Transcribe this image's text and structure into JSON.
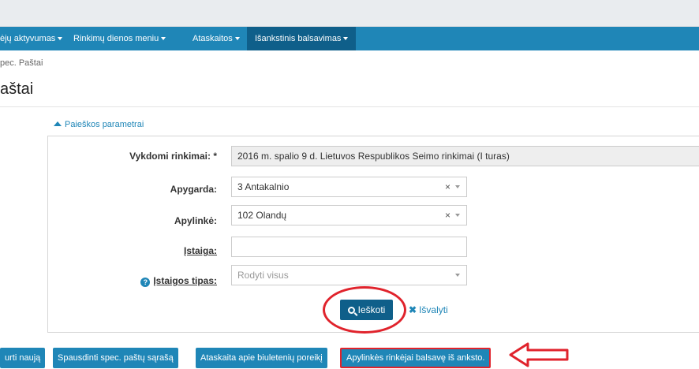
{
  "nav": {
    "items": [
      {
        "label": "ėjų aktyvumas",
        "active": false
      },
      {
        "label": "Rinkimų dienos meniu",
        "active": false
      },
      {
        "label": "Ataskaitos",
        "active": false
      },
      {
        "label": "Išankstinis balsavimas",
        "active": true
      }
    ]
  },
  "breadcrumb": "pec. Paštai",
  "page_title": "aštai",
  "search": {
    "toggle_label": "Paieškos parametrai",
    "fields": {
      "elections": {
        "label": "Vykdomi rinkimai: *",
        "value": "2016 m. spalio 9 d. Lietuvos Respublikos Seimo rinkimai (I turas)"
      },
      "district": {
        "label": "Apygarda:",
        "value": "3 Antakalnio",
        "clear": "×"
      },
      "ward": {
        "label": "Apylinkė:",
        "value": "102 Olandų",
        "clear": "×"
      },
      "institution": {
        "label": "Įstaiga:",
        "value": ""
      },
      "institution_type": {
        "label": "Įstaigos tipas:",
        "placeholder": "Rodyti visus"
      }
    },
    "search_button": "Ieškoti",
    "clear_link": "Išvalyti"
  },
  "actions": {
    "create": "urti naują",
    "print_list": "Spausdinti spec. paštų sąrašą",
    "ballot_report": "Ataskaita apie biuletenių poreikį",
    "ward_voters": "Apylinkės rinkėjai balsavę iš anksto."
  },
  "colors": {
    "accent": "#1f86b7",
    "accent_dark": "#0f5f8a",
    "annotation": "#e0232c"
  },
  "icons": {
    "search": "magnifier-icon",
    "clear": "x-icon",
    "help": "question-circle-icon",
    "toggle": "triangle-up-icon"
  }
}
